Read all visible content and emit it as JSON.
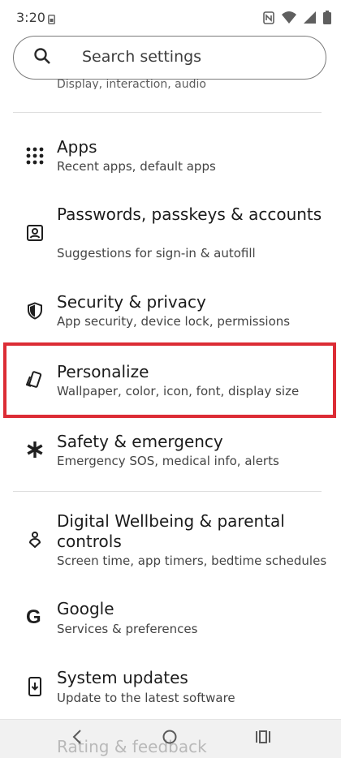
{
  "status_bar": {
    "time": "3:20",
    "icons": [
      "sim-icon",
      "nfc-icon",
      "wifi-icon",
      "signal-icon",
      "battery-icon"
    ]
  },
  "search": {
    "placeholder": "Search settings"
  },
  "scrolled_item": {
    "subtitle": "Display, interaction, audio"
  },
  "items": [
    {
      "title": "Apps",
      "subtitle": "Recent apps, default apps",
      "icon": "apps-grid-icon"
    },
    {
      "title": "Passwords, passkeys & accounts",
      "subtitle": "Suggestions for sign-in & autofill",
      "icon": "account-box-icon"
    },
    {
      "title": "Security & privacy",
      "subtitle": "App security, device lock, permissions",
      "icon": "shield-icon"
    },
    {
      "title": "Personalize",
      "subtitle": "Wallpaper, color, icon, font, display size",
      "icon": "personalize-icon"
    },
    {
      "title": "Safety & emergency",
      "subtitle": "Emergency SOS, medical info, alerts",
      "icon": "asterisk-icon"
    },
    {
      "title": "Digital Wellbeing & parental controls",
      "subtitle": "Screen time, app timers, bedtime schedules",
      "icon": "wellbeing-icon"
    },
    {
      "title": "Google",
      "subtitle": "Services & preferences",
      "icon": "google-icon"
    },
    {
      "title": "System updates",
      "subtitle": "Update to the latest software",
      "icon": "system-update-icon"
    }
  ],
  "peek_item": {
    "title": "Rating & feedback"
  },
  "colors": {
    "highlight": "#dc2c35"
  }
}
